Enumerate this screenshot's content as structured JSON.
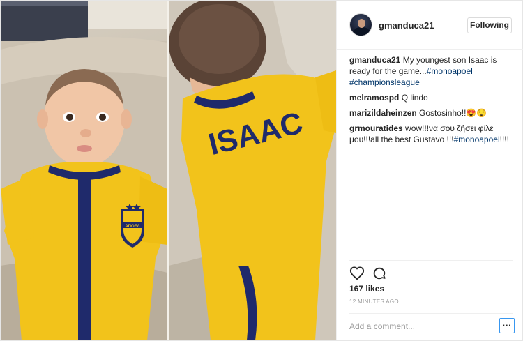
{
  "header": {
    "username": "gmanduca21",
    "follow_label": "Following"
  },
  "photo": {
    "shirt_text": "ISAAC",
    "crest_text": "ΑΠΟΕΛ"
  },
  "comments": [
    {
      "user": "gmanduca21",
      "text": "My youngest son Isaac is ready for the game...",
      "tags": [
        "#monoapoel",
        "#championsleague"
      ]
    },
    {
      "user": "melramospd",
      "text": "Q lindo"
    },
    {
      "user": "marizildaheinzen",
      "text": "Gostosinho!!😍😲"
    },
    {
      "user": "grmouratides",
      "text": "wow!!!να σου ζήσει φίλε μου!!!all the best Gustavo !!!",
      "tag": "#monoapoel",
      "suffix": "!!!!"
    }
  ],
  "actions": {
    "like_icon": "heart-icon",
    "comment_icon": "comment-bubble-icon",
    "likes_text": "167 likes",
    "timestamp": "12 minutes ago"
  },
  "add_comment": {
    "placeholder": "Add a comment...",
    "more_label": "···"
  },
  "colors": {
    "link": "#003569",
    "shirt_yellow": "#f2c31b",
    "shirt_navy": "#1f2a6b",
    "focus_blue": "#3897f0"
  }
}
